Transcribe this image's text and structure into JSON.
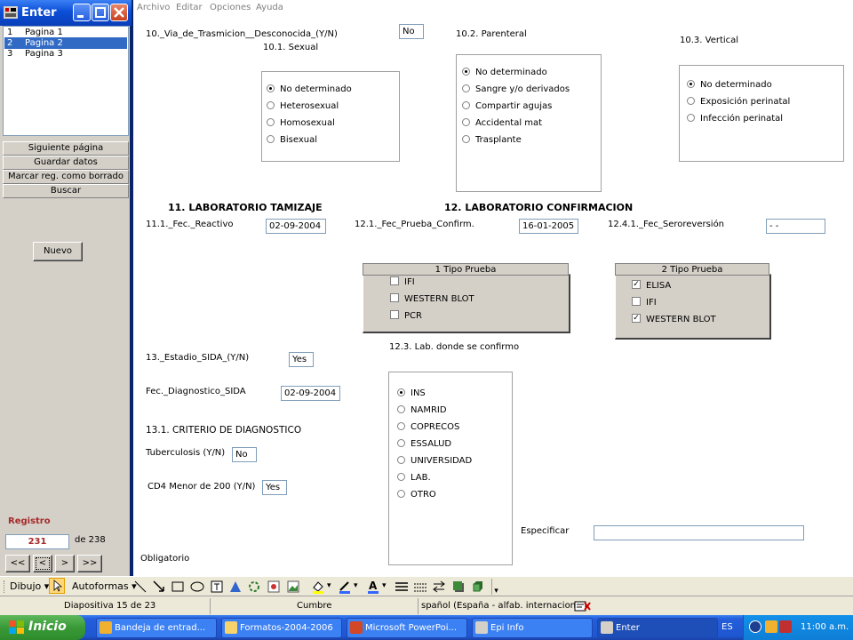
{
  "enter_window": {
    "title": "Enter",
    "pages": [
      {
        "num": "1",
        "label": "Pagina 1"
      },
      {
        "num": "2",
        "label": "Pagina 2"
      },
      {
        "num": "3",
        "label": "Pagina 3"
      }
    ],
    "nav_buttons": [
      "Siguiente página",
      "Guardar datos",
      "Marcar reg. como borrado",
      "Buscar"
    ],
    "nuevo": "Nuevo",
    "registro_label": "Registro",
    "registro_value": "231",
    "registro_of": "de 238",
    "nav_first": "<<",
    "nav_prev": "<",
    "nav_next": ">",
    "nav_last": ">>"
  },
  "menu": [
    "Archivo",
    "Editar",
    "Opciones",
    "Ayuda"
  ],
  "form": {
    "q10_label": "10._Via_de_Trasmicion__Desconocida_(Y/N)",
    "q10_value": "No",
    "q10_1_label": "10.1. Sexual",
    "q10_1_options": [
      "No determinado",
      "Heterosexual",
      "Homosexual",
      "Bisexual"
    ],
    "q10_2_label": "10.2. Parenteral",
    "q10_2_options": [
      "No determinado",
      "Sangre y/o derivados",
      "Compartir agujas",
      "Accidental mat",
      "Trasplante"
    ],
    "q10_3_label": "10.3. Vertical",
    "q10_3_options": [
      "No determinado",
      "Exposición perinatal",
      "Infección perinatal"
    ],
    "h11": "11. LABORATORIO TAMIZAJE",
    "h12": "12. LABORATORIO CONFIRMACION",
    "q11_1_label": "11.1._Fec._Reactivo",
    "q11_1_value": "02-09-2004",
    "q12_1_label": "12.1._Fec_Prueba_Confirm.",
    "q12_1_value": "16-01-2005",
    "q12_4_1_label": "12.4.1._Fec_Seroreversión",
    "q12_4_1_value": "- -",
    "tipo1_title": "1 Tipo Prueba",
    "tipo1_items": [
      {
        "label": "IFI",
        "mark": ""
      },
      {
        "label": "WESTERN BLOT",
        "mark": ""
      },
      {
        "label": "PCR",
        "mark": ""
      }
    ],
    "tipo2_title": "2 Tipo Prueba",
    "tipo2_items": [
      {
        "label": "ELISA",
        "mark": "✓"
      },
      {
        "label": "IFI",
        "mark": ""
      },
      {
        "label": "WESTERN BLOT",
        "mark": "✓"
      }
    ],
    "q12_3_label": "12.3. Lab. donde se confirmo",
    "q12_3_options": [
      "INS",
      "NAMRID",
      "COPRECOS",
      "ESSALUD",
      "UNIVERSIDAD",
      "LAB.",
      "OTRO"
    ],
    "q13_label": "13._Estadio_SIDA_(Y/N)",
    "q13_value": "Yes",
    "fec_diag_label": "Fec._Diagnostico_SIDA",
    "fec_diag_value": "02-09-2004",
    "q13_1_label": "13.1. CRITERIO DE DIAGNOSTICO",
    "tb_label": "Tuberculosis (Y/N)",
    "tb_value": "No",
    "cd4_label": "CD4 Menor de 200 (Y/N)",
    "cd4_value": "Yes",
    "especificar_label": "Especificar",
    "especificar_value": "",
    "obligatorio": "Obligatorio"
  },
  "drawbar": {
    "dibujo": "Dibujo",
    "autoformas": "Autoformas"
  },
  "statusbar": {
    "slide": "Diapositiva 15 de 23",
    "theme": "Cumbre",
    "language": "spañol (España - alfab. internacional"
  },
  "taskbar": {
    "start": "Inicio",
    "tasks": [
      "Bandeja de entrad...",
      "Formatos-2004-2006",
      "Microsoft PowerPoi...",
      "Epi Info",
      "Enter"
    ],
    "lang": "ES",
    "clock": "11:00 a.m."
  },
  "colors": {
    "titlebar": "#0b4ed8",
    "selection": "#316ac5",
    "taskbar": "#245edb",
    "start": "#3a9a37"
  }
}
